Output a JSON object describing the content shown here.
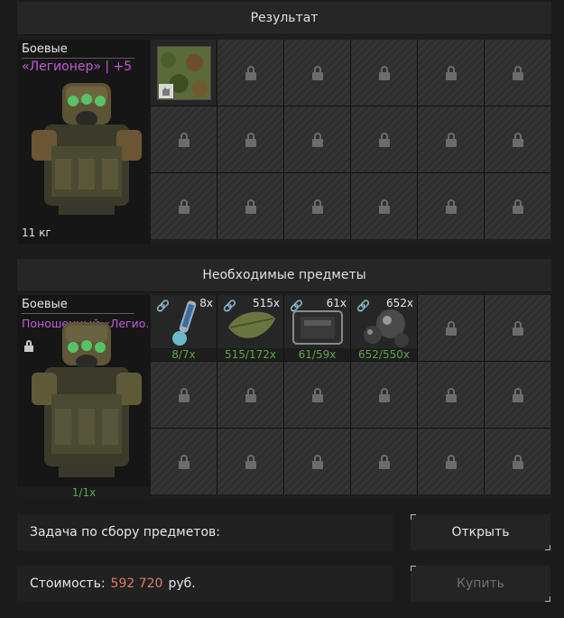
{
  "result": {
    "title": "Результат",
    "item": {
      "category": "Боевые",
      "name": "«Легионер» | +5",
      "weight": "11 кг"
    },
    "unlocked_slot_icon": "camouflage-pattern-icon"
  },
  "required": {
    "title": "Необходимые предметы",
    "item": {
      "category": "Боевые",
      "name": "Поношенный «Легио..",
      "count": "1/1x"
    },
    "materials": [
      {
        "icon": "injector-icon",
        "qty": "8x",
        "have": "8/7x"
      },
      {
        "icon": "leaf-icon",
        "qty": "515x",
        "have": "515/172x"
      },
      {
        "icon": "tablet-device-icon",
        "qty": "61x",
        "have": "61/59x"
      },
      {
        "icon": "metal-spheres-icon",
        "qty": "652x",
        "have": "652/550x"
      }
    ]
  },
  "task": {
    "label": "Задача по сбору предметов:",
    "open_button": "Открыть"
  },
  "cost": {
    "label": "Стоимость:",
    "value": "592 720",
    "currency": "руб.",
    "buy_button": "Купить"
  },
  "colors": {
    "rarity_purple": "#c05ad8",
    "have_green": "#5fa64a",
    "price_red": "#e07a6a"
  }
}
